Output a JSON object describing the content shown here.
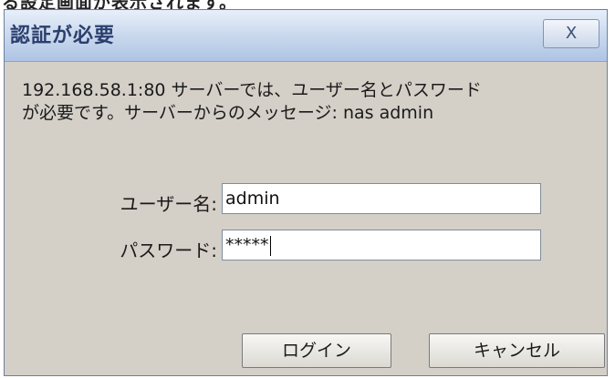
{
  "page_heading_fragment": "る設定画面が表示されます。",
  "dialog": {
    "title": "認証が必要",
    "close_glyph": "X",
    "message_line1": "192.168.58.1:80 サーバーでは、ユーザー名とパスワード",
    "message_line2": "が必要です。サーバーからのメッセージ: nas admin"
  },
  "form": {
    "username_label": "ユーザー名:",
    "username_value": "admin",
    "password_label": "パスワード:",
    "password_value": "*****"
  },
  "buttons": {
    "login": "ログイン",
    "cancel": "キャンセル"
  }
}
